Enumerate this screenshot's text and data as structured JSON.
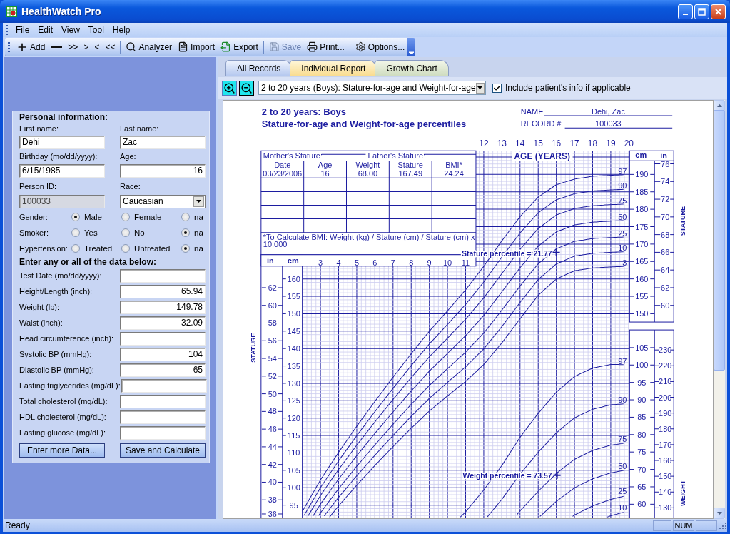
{
  "window": {
    "title": "HealthWatch Pro"
  },
  "menu": [
    "File",
    "Edit",
    "View",
    "Tool",
    "Help"
  ],
  "toolbar": {
    "groups": [
      [
        {
          "label": "Add",
          "disabled": false
        },
        {
          "disabled": false
        },
        {
          "label": ">>",
          "disabled": false
        },
        {
          "label": ">",
          "disabled": false
        },
        {
          "label": "<",
          "disabled": false
        },
        {
          "label": "<<",
          "disabled": false
        }
      ],
      [
        {
          "label": "Analyzer",
          "disabled": false
        },
        {
          "label": "Import",
          "disabled": false
        },
        {
          "label": "Export",
          "disabled": false
        }
      ],
      [
        {
          "label": "Save",
          "disabled": true
        },
        {
          "label": "Print...",
          "disabled": false
        }
      ],
      [
        {
          "label": "Options...",
          "disabled": false
        }
      ]
    ]
  },
  "form": {
    "personal": {
      "title": "Personal information:",
      "pairs": [
        [
          {
            "label": "First name:",
            "value": "Dehi",
            "kind": "text",
            "disabled": false
          },
          {
            "label": "Last name:",
            "value": "Zac",
            "kind": "text",
            "disabled": false
          }
        ],
        [
          {
            "label": "Birthday (mo/dd/yyyy):",
            "value": "6/15/1985",
            "kind": "text",
            "disabled": false
          },
          {
            "label": "Age:",
            "value": "16",
            "kind": "number",
            "disabled": false
          }
        ],
        [
          {
            "label": "Person ID:",
            "value": "100033",
            "kind": "text",
            "disabled": true
          },
          {
            "label": "Race:",
            "value": "Caucasian",
            "kind": "select",
            "disabled": false
          }
        ]
      ]
    },
    "radio_groups": [
      {
        "label": "Gender:",
        "options": [
          {
            "label": "Male",
            "selected": true
          },
          {
            "label": "Female",
            "selected": false
          },
          {
            "label": "na",
            "selected": false
          }
        ]
      },
      {
        "label": "Smoker:",
        "options": [
          {
            "label": "Yes",
            "selected": false
          },
          {
            "label": "No",
            "selected": false
          },
          {
            "label": "na",
            "selected": true
          }
        ]
      },
      {
        "label": "Hypertension:",
        "options": [
          {
            "label": "Treated",
            "selected": false
          },
          {
            "label": "Untreated",
            "selected": false
          },
          {
            "label": "na",
            "selected": true
          }
        ]
      }
    ],
    "data": {
      "title": "Enter any or all of the data below:",
      "fields": [
        {
          "label": "Test Date (mo/dd/yyyy):"
        },
        {
          "label": "Height/Length (inch):",
          "value": "65.94"
        },
        {
          "label": "Weight (lb):",
          "value": "149.78"
        },
        {
          "label": "Waist (inch):",
          "value": "32.09"
        },
        {
          "label": "Head circumference (inch):"
        },
        {
          "label": "Systolic BP (mmHg):",
          "value": "104"
        },
        {
          "label": "Diastolic BP (mmHg):",
          "value": "65"
        },
        {
          "label": "Fasting triglycerides (mg/dL):"
        },
        {
          "label": "Total cholesterol (mg/dL):"
        },
        {
          "label": "HDL cholesterol (mg/dL):"
        },
        {
          "label": "Fasting glucose (mg/dL):"
        }
      ]
    },
    "buttons": [
      "Enter more Data...",
      "Save and Calculate"
    ]
  },
  "tabs": [
    {
      "label": "All Records",
      "selected": false,
      "hovered": false
    },
    {
      "label": "Individual Report",
      "selected": false,
      "hovered": true
    },
    {
      "label": "Growth Chart",
      "selected": true,
      "hovered": false
    }
  ],
  "chart_toolbar": {
    "chart_type": "2 to 20 years (Boys): Stature-for-age and Weight-for-age",
    "include_info": {
      "label": "Include patient's info if applicable",
      "checked": true
    }
  },
  "chart": {
    "title_lines": [
      "2 to 20 years: Boys",
      "Stature-for-age and Weight-for-age percentiles"
    ],
    "name_label": "NAME",
    "name_value": "Dehi, Zac",
    "record_label": "RECORD #",
    "record_value": "100033",
    "age_axis_title": "AGE (YEARS)",
    "upper_ages": [
      "12",
      "13",
      "14",
      "15",
      "16",
      "17",
      "18",
      "19",
      "20"
    ],
    "lower_ages": [
      "3",
      "4",
      "5",
      "6",
      "7",
      "8",
      "9",
      "10",
      "11"
    ],
    "right_cm_unit": "cm",
    "right_in_unit": "in",
    "left_in_unit": "in",
    "left_cm_unit": "cm",
    "right_cm_ticks": [
      "190",
      "185",
      "180",
      "175",
      "170",
      "165",
      "160",
      "155",
      "150"
    ],
    "right_in_ticks": [
      "76",
      "74",
      "72",
      "70",
      "68",
      "66",
      "64",
      "62",
      "60"
    ],
    "left_cm_ticks": [
      "160",
      "155",
      "150",
      "145",
      "140",
      "135",
      "130",
      "125",
      "120",
      "115",
      "110",
      "105",
      "100",
      "95"
    ],
    "left_in_ticks": [
      "62",
      "60",
      "58",
      "56",
      "54",
      "52",
      "50",
      "48",
      "46",
      "44",
      "42",
      "40",
      "38",
      "36"
    ],
    "weight_kg_ticks": [
      "105",
      "100",
      "95",
      "90",
      "85",
      "80",
      "75",
      "70",
      "65",
      "60"
    ],
    "weight_lb_ticks": [
      "230",
      "220",
      "210",
      "200",
      "190",
      "180",
      "170",
      "160",
      "150",
      "140",
      "130"
    ],
    "stature_percentiles": [
      "97",
      "90",
      "75",
      "50",
      "25",
      "10",
      "3"
    ],
    "weight_percentiles": [
      "97",
      "90",
      "75",
      "50",
      "25",
      "10"
    ],
    "stature_axis_titles": [
      "STATURE",
      "STATURE"
    ],
    "weight_axis_title": "WEIGHT",
    "stature_result": "Stature percentile = 21.77",
    "weight_result": "Weight percentile = 73.57",
    "table": {
      "mother_label": "Mother's Stature:",
      "father_label": "Father's Stature:",
      "columns": [
        "Date",
        "Age",
        "Weight",
        "Stature",
        "BMI*"
      ],
      "rows": [
        [
          "03/23/2006",
          "16",
          "68.00",
          "167.49",
          "24.24"
        ]
      ],
      "note_lines": [
        "*To Calculate BMI: Weight (kg) / Stature (cm) / Stature (cm) x",
        "10,000"
      ]
    }
  },
  "status_bar": {
    "text": "Ready",
    "panels": [
      "NUM"
    ]
  }
}
